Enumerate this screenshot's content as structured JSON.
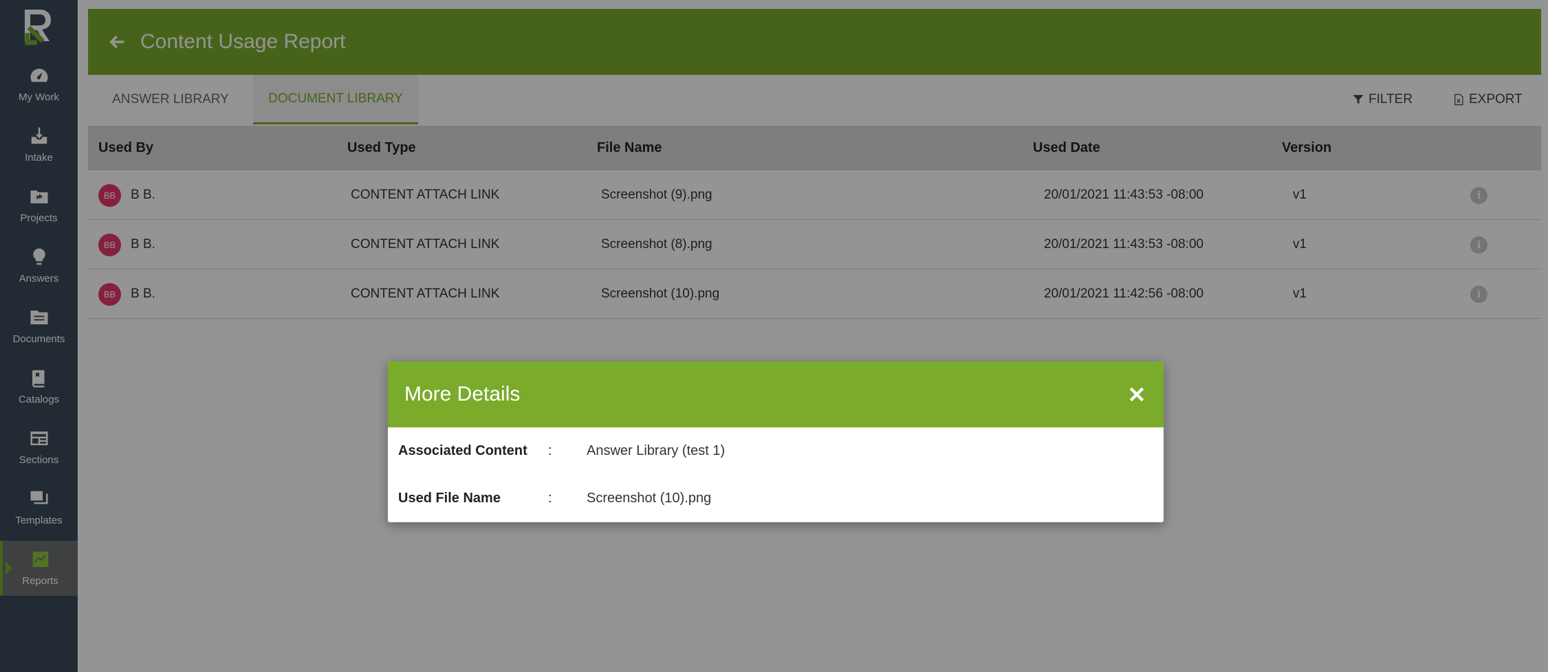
{
  "sidebar": {
    "logo": "R",
    "items": [
      {
        "label": "My Work",
        "icon": "speedometer-icon"
      },
      {
        "label": "Intake",
        "icon": "inbox-download-icon"
      },
      {
        "label": "Projects",
        "icon": "folder-share-icon"
      },
      {
        "label": "Answers",
        "icon": "lightbulb-icon"
      },
      {
        "label": "Documents",
        "icon": "documents-icon"
      },
      {
        "label": "Catalogs",
        "icon": "book-icon"
      },
      {
        "label": "Sections",
        "icon": "sections-icon"
      },
      {
        "label": "Templates",
        "icon": "templates-icon"
      },
      {
        "label": "Reports",
        "icon": "chart-icon",
        "active": true
      }
    ]
  },
  "header": {
    "title": "Content Usage Report"
  },
  "tabs": [
    {
      "label": "ANSWER LIBRARY",
      "active": false
    },
    {
      "label": "DOCUMENT LIBRARY",
      "active": true
    }
  ],
  "toolbar": {
    "filter_label": "FILTER",
    "export_label": "EXPORT"
  },
  "table": {
    "columns": [
      "Used By",
      "Used Type",
      "File Name",
      "Used Date",
      "Version"
    ],
    "rows": [
      {
        "avatar": "BB",
        "used_by": "B B.",
        "used_type": "CONTENT ATTACH LINK",
        "file_name": "Screenshot (9).png",
        "used_date": "20/01/2021 11:43:53 -08:00",
        "version": "v1"
      },
      {
        "avatar": "BB",
        "used_by": "B B.",
        "used_type": "CONTENT ATTACH LINK",
        "file_name": "Screenshot (8).png",
        "used_date": "20/01/2021 11:43:53 -08:00",
        "version": "v1"
      },
      {
        "avatar": "BB",
        "used_by": "B B.",
        "used_type": "CONTENT ATTACH LINK",
        "file_name": "Screenshot (10).png",
        "used_date": "20/01/2021 11:42:56 -08:00",
        "version": "v1"
      }
    ]
  },
  "modal": {
    "title": "More Details",
    "details": [
      {
        "label": "Associated Content",
        "separator": ":",
        "value": "Answer Library (test 1)"
      },
      {
        "label": "Used File Name",
        "separator": ":",
        "value": "Screenshot (10).png"
      }
    ]
  },
  "colors": {
    "brand_green": "#7aab2b",
    "sidebar_bg": "#3b4b5a",
    "avatar_pink": "#e6376b"
  }
}
